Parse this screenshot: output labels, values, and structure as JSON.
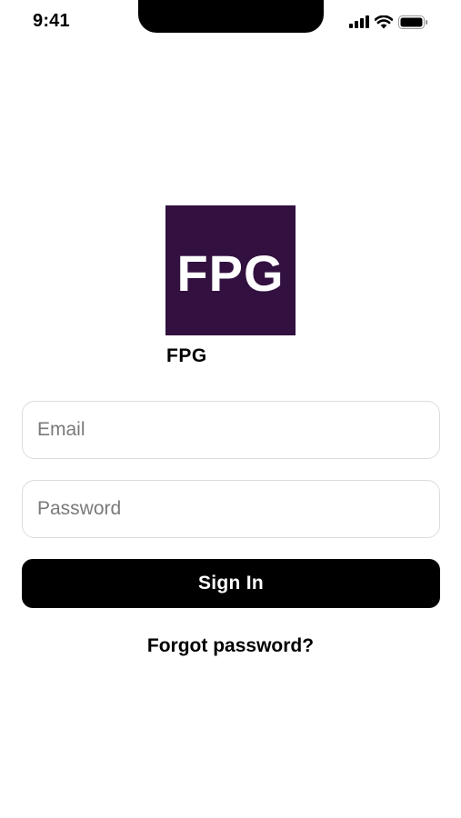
{
  "status_bar": {
    "time": "9:41",
    "icons": [
      "cellular-signal-icon",
      "wifi-icon",
      "battery-icon"
    ]
  },
  "logo": {
    "text": "FPG",
    "background_color": "#32103f",
    "text_color": "#ffffff"
  },
  "app": {
    "name": "FPG"
  },
  "form": {
    "email": {
      "value": "",
      "placeholder": "Email"
    },
    "password": {
      "value": "",
      "placeholder": "Password"
    },
    "submit_label": "Sign In",
    "forgot_label": "Forgot password?"
  },
  "colors": {
    "primary_button": "#000000",
    "primary_button_text": "#ffffff",
    "input_border": "#dcdcdc",
    "placeholder": "#7a7a7a"
  }
}
